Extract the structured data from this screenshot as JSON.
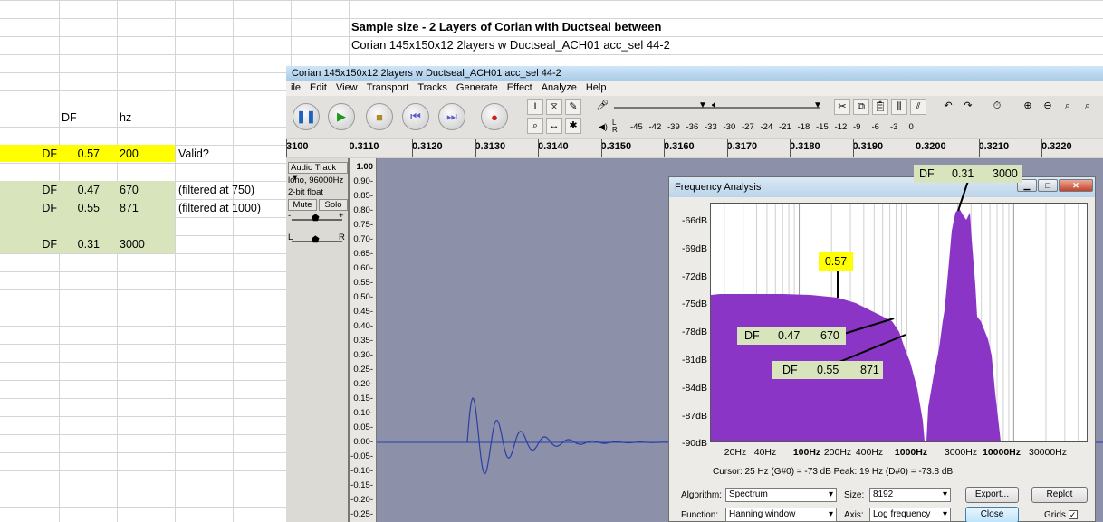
{
  "sheet": {
    "title": "Sample size - 2 Layers of Corian with Ductseal between",
    "subtitle": "Corian 145x150x12 2layers w Ductseal_ACH01 acc_sel 44-2",
    "header_df": "DF",
    "header_hz": "hz",
    "rows": [
      {
        "label": "DF",
        "df": "0.57",
        "hz": "200",
        "note": "Valid?"
      },
      {
        "label": "DF",
        "df": "0.47",
        "hz": "670",
        "note": "(filtered at 750)"
      },
      {
        "label": "DF",
        "df": "0.55",
        "hz": "871",
        "note": "(filtered at 1000)"
      },
      {
        "label": "DF",
        "df": "0.31",
        "hz": "3000",
        "note": ""
      }
    ],
    "highlight_yellow": "#ffff00",
    "highlight_green": "#d8e4bc"
  },
  "audacity": {
    "window_title": "Corian 145x150x12 2layers w Ductseal_ACH01 acc_sel 44-2",
    "menu": [
      "ile",
      "Edit",
      "View",
      "Transport",
      "Tracks",
      "Generate",
      "Effect",
      "Analyze",
      "Help"
    ],
    "meter_ticks": [
      "-45",
      "-42",
      "-39",
      "-36",
      "-33",
      "-30",
      "-27",
      "-24",
      "-21",
      "-18",
      "-15",
      "-12",
      "-9",
      "-6",
      "-3",
      "0"
    ],
    "meter_l": "L",
    "meter_r": "R",
    "ruler_ticks": [
      "3100",
      "0.3110",
      "0.3120",
      "0.3130",
      "0.3140",
      "0.3150",
      "0.3160",
      "0.3170",
      "0.3180",
      "0.3190",
      "0.3200",
      "0.3210",
      "0.3220",
      "0.3"
    ],
    "track": {
      "name": "Audio Track",
      "rate": "lono, 96000Hz",
      "format": "2-bit float",
      "mute": "Mute",
      "solo": "Solo",
      "pan_l": "L",
      "pan_r": "R",
      "gain_minus": "-",
      "gain_plus": "+"
    },
    "amp_labels": [
      "1.00",
      "0.90-",
      "0.85-",
      "0.80-",
      "0.75-",
      "0.70-",
      "0.65-",
      "0.60-",
      "0.55-",
      "0.50-",
      "0.45-",
      "0.40-",
      "0.35-",
      "0.30-",
      "0.25-",
      "0.20-",
      "0.15-",
      "0.10-",
      "0.05-",
      "0.00-",
      "-0.05-",
      "-0.10-",
      "-0.15-",
      "-0.20-",
      "-0.25-"
    ],
    "wave_bg": "#8c91a9",
    "wave_color": "#2a3ea8"
  },
  "freq_analysis": {
    "title": "Frequency Analysis",
    "db_labels": [
      "-66dB",
      "-69dB",
      "-72dB",
      "-75dB",
      "-78dB",
      "-81dB",
      "-84dB",
      "-87dB",
      "-90dB"
    ],
    "freq_labels": [
      "20Hz",
      "40Hz",
      "100Hz",
      "200Hz",
      "400Hz",
      "1000Hz",
      "3000Hz",
      "10000Hz",
      "30000Hz"
    ],
    "cursor_text": "Cursor: 25 Hz (G#0) = -73 dB   Peak: 19 Hz (D#0) = -73.8 dB",
    "algorithm_label": "Algorithm:",
    "algorithm_value": "Spectrum",
    "size_label": "Size:",
    "size_value": "8192",
    "function_label": "Function:",
    "function_value": "Hanning window",
    "axis_label": "Axis:",
    "axis_value": "Log frequency",
    "export_label": "Export...",
    "replot_label": "Replot",
    "close_label": "Close",
    "grids_label": "Grids",
    "grids_checked": "✓",
    "spectrum_color": "#8b35c7"
  },
  "annotations": {
    "a1": {
      "label": "DF",
      "df": "0.31",
      "hz": "3000"
    },
    "a2": {
      "value": "0.57"
    },
    "a3": {
      "label": "DF",
      "df": "0.47",
      "hz": "670"
    },
    "a4": {
      "label": "DF",
      "df": "0.55",
      "hz": "871"
    }
  }
}
